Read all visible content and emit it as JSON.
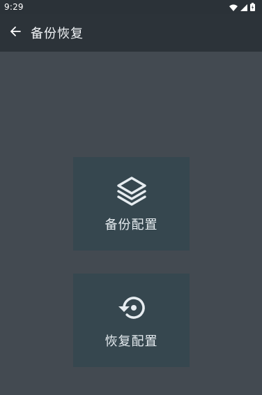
{
  "status_bar": {
    "time": "9:29",
    "icons": [
      "wifi-icon",
      "signal-icon",
      "battery-icon"
    ]
  },
  "app_bar": {
    "back_icon": "arrow-left-icon",
    "title": "备份恢复"
  },
  "actions": {
    "backup": {
      "icon": "layers-icon",
      "label": "备份配置"
    },
    "restore": {
      "icon": "restore-icon",
      "label": "恢复配置"
    }
  },
  "colors": {
    "background": "#434a51",
    "app_bar": "#2c3339",
    "card": "#36474f",
    "text": "#e6ecf0"
  }
}
